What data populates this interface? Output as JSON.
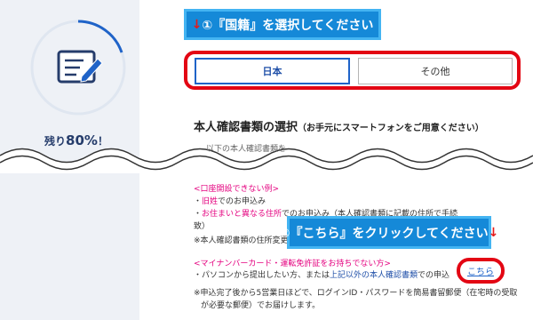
{
  "progress": {
    "remaining_text": "残り",
    "percent_text": "80%",
    "suffix": "！",
    "fraction_done": 0.2
  },
  "callouts": {
    "select_nationality": {
      "arrow": "↓",
      "text": "①『国籍』を選択してください"
    },
    "click_here": {
      "text": "②『こちら』をクリックしてください",
      "arrow": "↓"
    }
  },
  "nationality": {
    "options": [
      "日本",
      "その他"
    ],
    "selected": "日本"
  },
  "id_docs": {
    "title": "本人確認書類の選択",
    "subtitle": "（お手元にスマートフォンをご用意ください）",
    "partial_line": "以下の本人確認書類を",
    "cannot_open_heading": "<口座開設できない例>",
    "cannot_open_items": [
      {
        "prefix": "・",
        "highlight": "旧姓",
        "rest": "でのお申込み"
      },
      {
        "prefix": "・",
        "highlight": "お住まいと異なる住所",
        "rest": "でのお申込み（本人確認書類に記載の住所で手続"
      },
      {
        "prefix": "",
        "highlight": "",
        "rest": "致）"
      }
    ],
    "note_address": "※本人確認書類の住所変更",
    "no_card_heading": "<マイナンバーカード・運転免許証をお持ちでない方>",
    "no_card_line_prefix": "・パソコンから提出したい方、または",
    "no_card_line_link": "上記以外の本人確認書類",
    "no_card_line_suffix": "での申込",
    "kochira_link": "こちら",
    "footnote_1": "※申込完了後から5営業日ほどで、ログインID・パスワードを簡易書留郵便（在宅時の受取",
    "footnote_2": "が必要な郵便）でお届けします。"
  },
  "colors": {
    "accent_blue": "#1f63c8",
    "callout_blue": "#1589d8",
    "frame_red": "#e30613",
    "pink": "#e4007f"
  }
}
